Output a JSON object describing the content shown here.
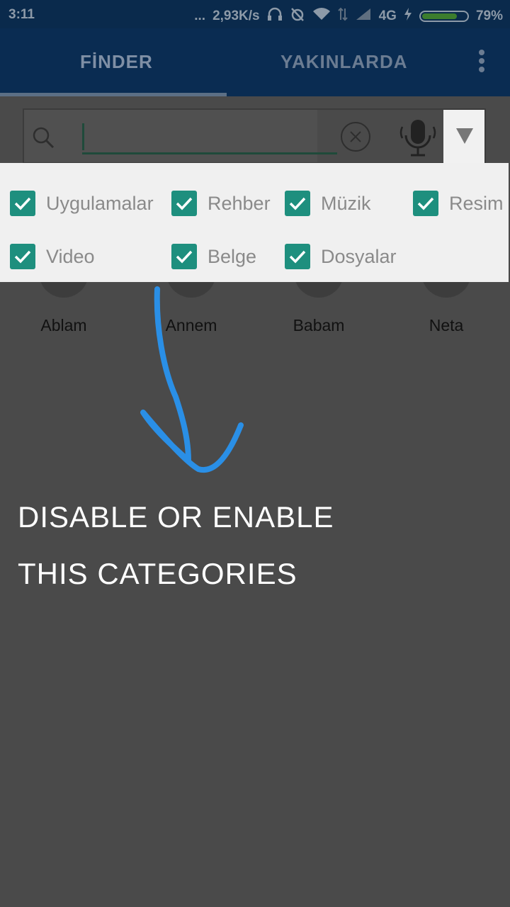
{
  "status_bar": {
    "time": "3:11",
    "speed": "2,93K/s",
    "network": "4G",
    "battery": "79%",
    "battery_level": 0.79,
    "dots": "..."
  },
  "app_bar": {
    "tabs": [
      {
        "label": "FİNDER",
        "selected": true
      },
      {
        "label": "YAKINLARDA",
        "selected": false
      }
    ],
    "overflow_icon": "more-vert-icon"
  },
  "search": {
    "value": "",
    "icons": [
      "search-icon",
      "clear-icon",
      "mic-icon",
      "dropdown-arrow-icon"
    ]
  },
  "categories": [
    {
      "label": "Uygulamalar",
      "checked": true
    },
    {
      "label": "Rehber",
      "checked": true
    },
    {
      "label": "Müzik",
      "checked": true
    },
    {
      "label": "Resim",
      "checked": true
    },
    {
      "label": "Video",
      "checked": true
    },
    {
      "label": "Belge",
      "checked": true
    },
    {
      "label": "Dosyalar",
      "checked": true
    }
  ],
  "contacts": [
    "Ablam",
    "Annem",
    "Babam",
    "Neta"
  ],
  "hint": {
    "line1": "DISABLE OR ENABLE",
    "line2": "THIS CATEGORIES"
  },
  "colors": {
    "checkbox": "#1e8f7e",
    "app_bar": "#0a2c52",
    "overlay": "#4a4a4a",
    "arrow": "#2a8fe6"
  }
}
